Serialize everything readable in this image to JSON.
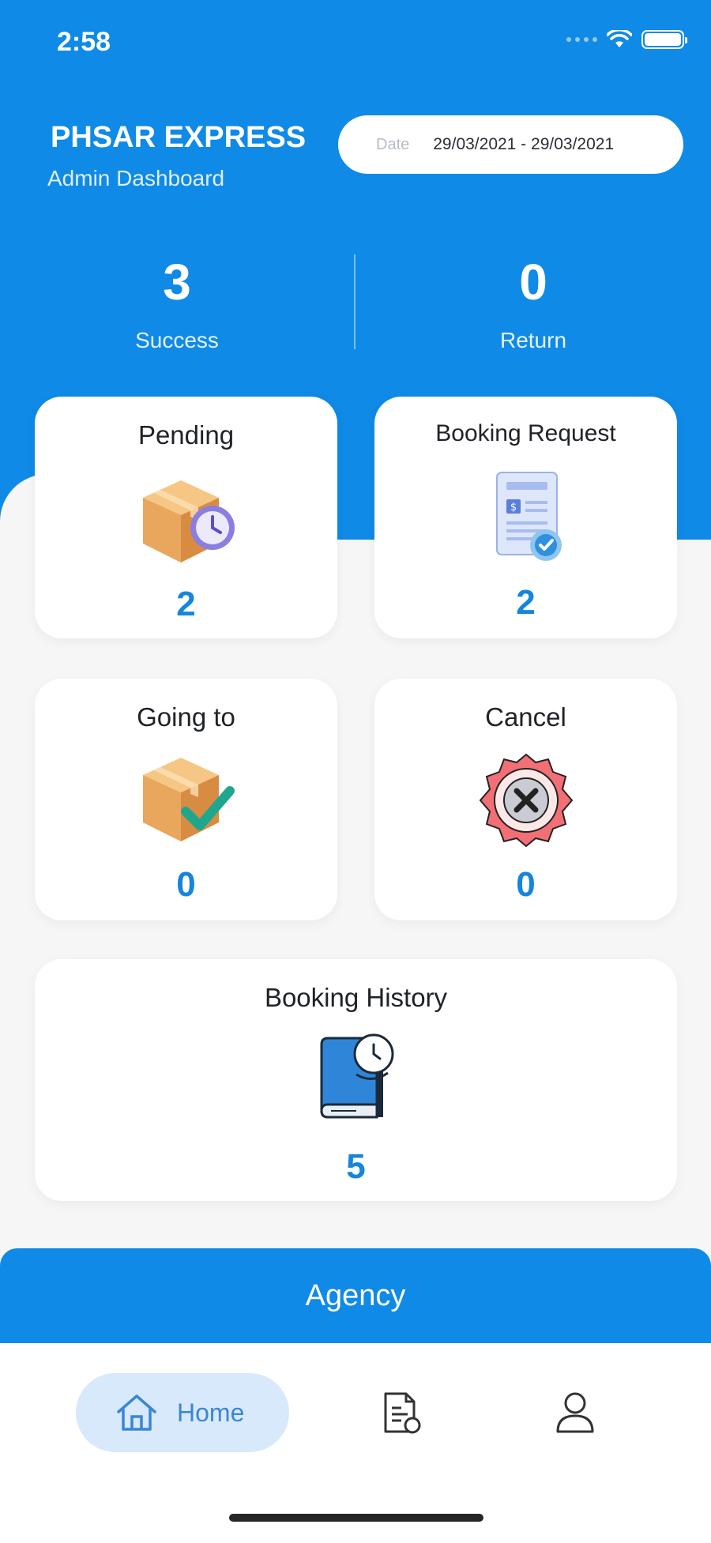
{
  "status_bar": {
    "time": "2:58"
  },
  "header": {
    "title": "PHSAR EXPRESS",
    "subtitle": "Admin Dashboard",
    "date_label": "Date",
    "date_range": "29/03/2021 - 29/03/2021"
  },
  "stats": [
    {
      "value": "3",
      "label": "Success"
    },
    {
      "value": "0",
      "label": "Return"
    }
  ],
  "cards": [
    {
      "title": "Pending",
      "count": "2",
      "icon": "box-clock-icon"
    },
    {
      "title": "Booking Request",
      "count": "2",
      "icon": "document-check-icon"
    },
    {
      "title": "Going to",
      "count": "0",
      "icon": "box-check-icon"
    },
    {
      "title": "Cancel",
      "count": "0",
      "icon": "cancel-badge-icon"
    },
    {
      "title": "Booking History",
      "count": "5",
      "icon": "book-clock-icon"
    }
  ],
  "agency": {
    "label": "Agency"
  },
  "tabbar": {
    "home_label": "Home",
    "items": [
      "home-icon",
      "document-icon",
      "profile-icon"
    ]
  },
  "colors": {
    "primary": "#0f8ae6",
    "count": "#1685de",
    "tab_highlight": "#d7e9fb"
  }
}
